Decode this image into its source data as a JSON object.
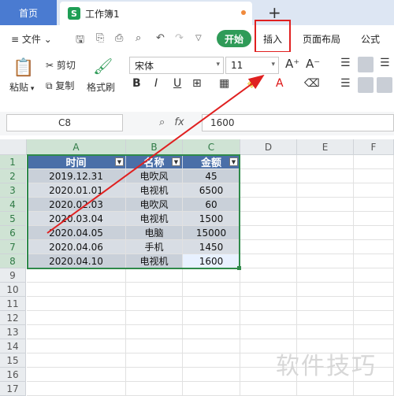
{
  "tabs": {
    "home": "首页",
    "doc": "工作簿1",
    "doc_icon": "S",
    "add": "+"
  },
  "menu": {
    "file": "文件",
    "start": "开始",
    "insert": "插入",
    "page_layout": "页面布局",
    "formula": "公式"
  },
  "ribbon": {
    "paste": "粘贴",
    "cut": "剪切",
    "copy": "复制",
    "format_painter": "格式刷",
    "font_name": "宋体",
    "font_size": "11",
    "grow": "A⁺",
    "shrink": "A⁻",
    "bold": "B",
    "italic": "I",
    "underline": "U"
  },
  "formula_bar": {
    "cell_ref": "C8",
    "fx": "fx",
    "value": "1600"
  },
  "columns": [
    "A",
    "B",
    "C",
    "D",
    "E",
    "F"
  ],
  "rows": [
    "1",
    "2",
    "3",
    "4",
    "5",
    "6",
    "7",
    "8",
    "9",
    "10",
    "11",
    "12",
    "13",
    "14",
    "15",
    "16",
    "17"
  ],
  "table": {
    "headers": [
      "时间",
      "名称",
      "金额"
    ],
    "rows": [
      [
        "2019.12.31",
        "电吹风",
        "45"
      ],
      [
        "2020.01.01",
        "电视机",
        "6500"
      ],
      [
        "2020.02.03",
        "电吹风",
        "60"
      ],
      [
        "2020.03.04",
        "电视机",
        "1500"
      ],
      [
        "2020.04.05",
        "电脑",
        "15000"
      ],
      [
        "2020.04.06",
        "手机",
        "1450"
      ],
      [
        "2020.04.10",
        "电视机",
        "1600"
      ]
    ]
  },
  "watermark": "软件技巧",
  "colors": {
    "accent_green": "#2f9b58",
    "highlight_red": "#e02020",
    "header_blue": "#4a6fa8"
  }
}
